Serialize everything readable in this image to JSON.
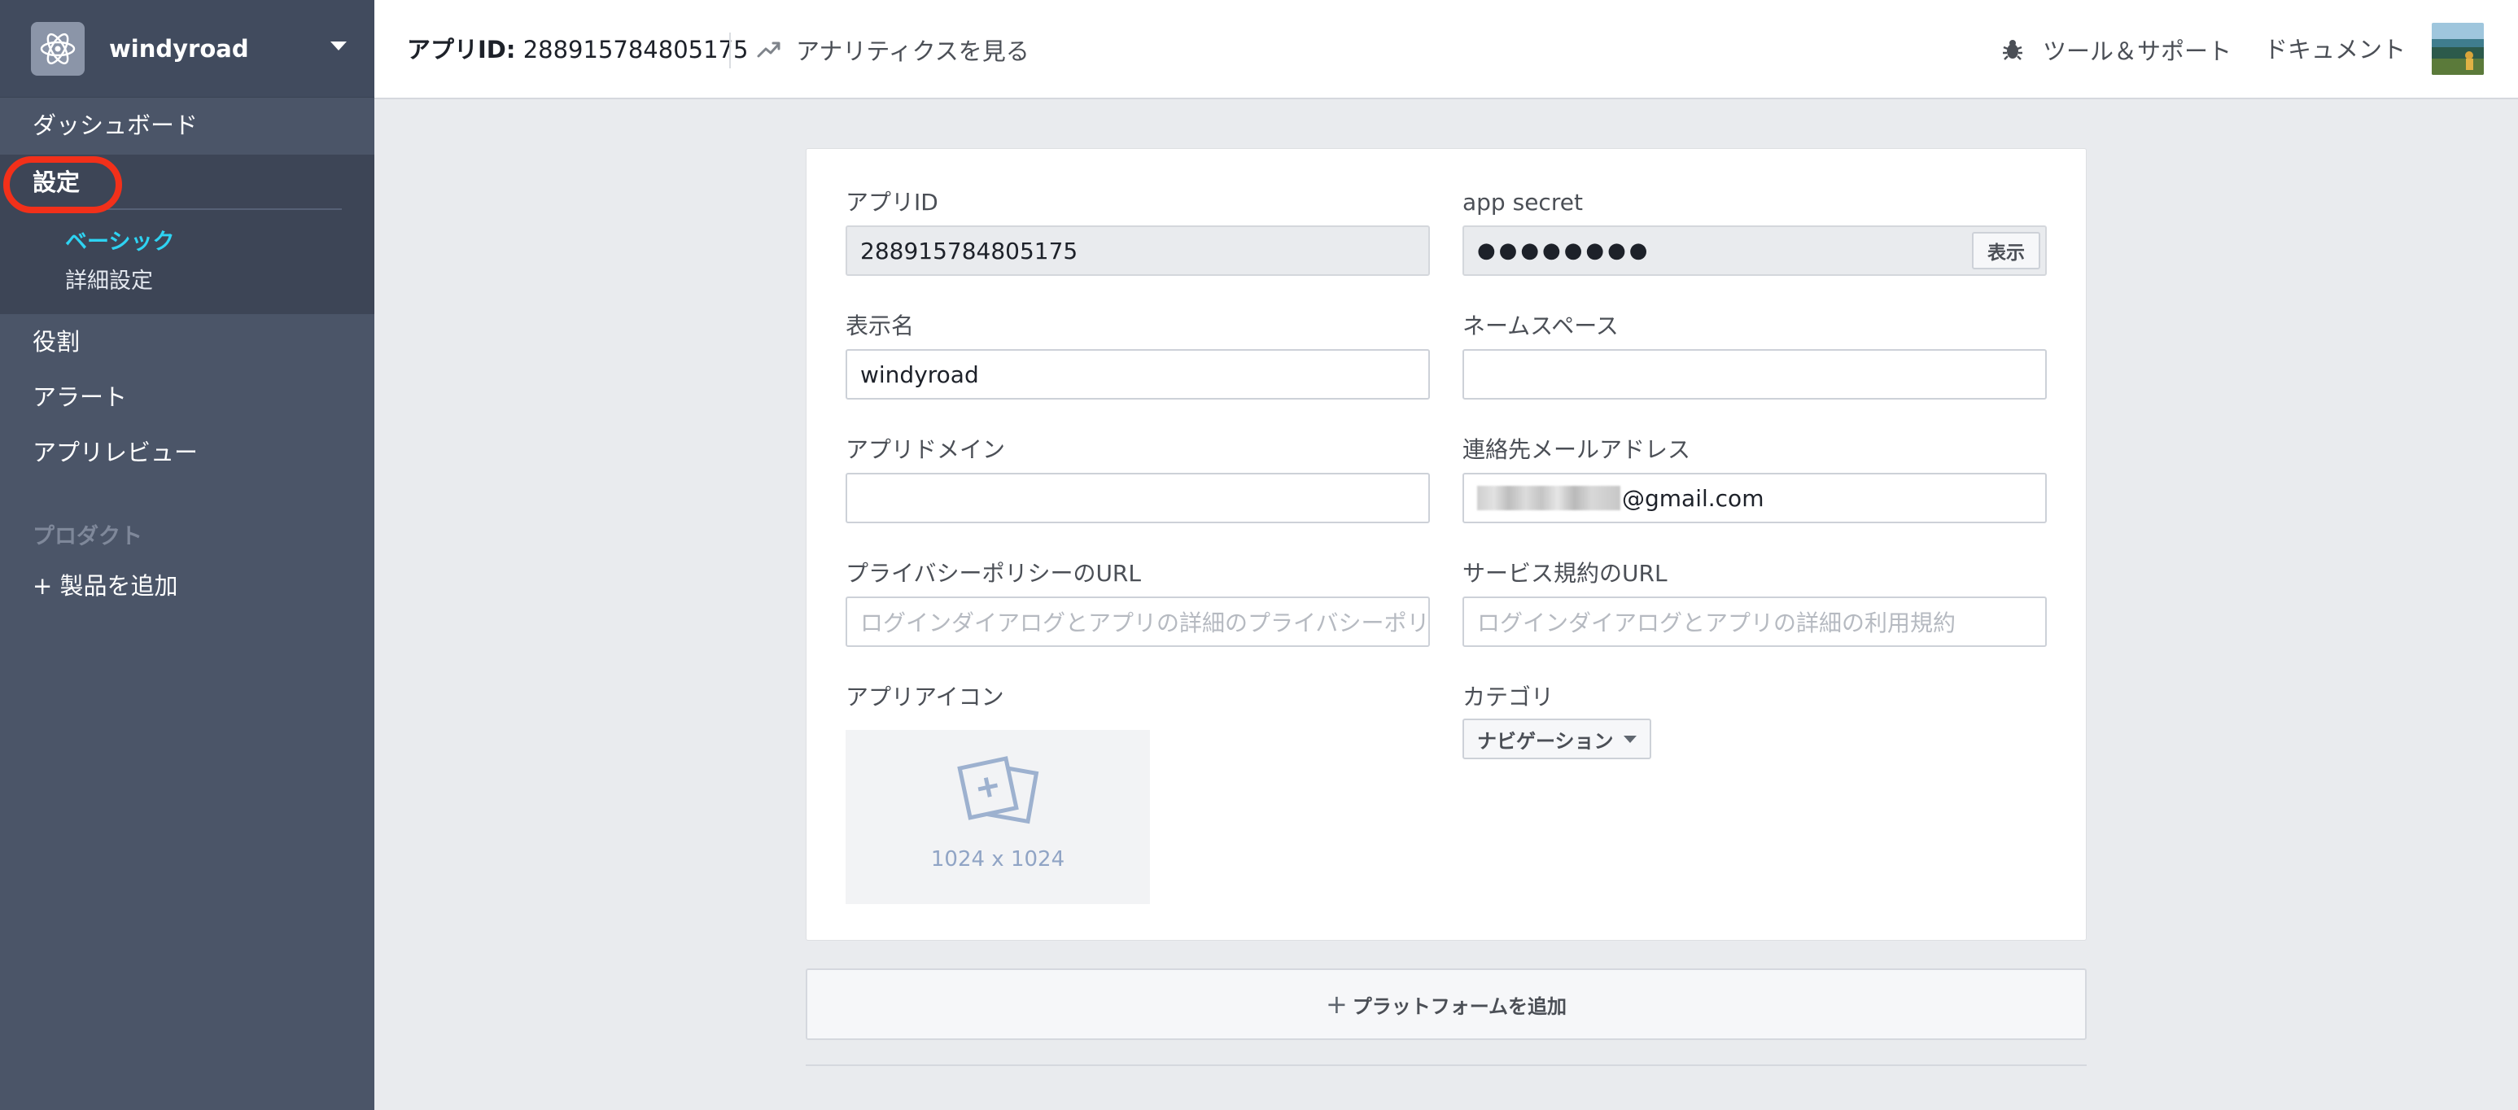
{
  "sidebar": {
    "app_name": "windyroad",
    "items": [
      {
        "label": "ダッシュボード"
      },
      {
        "label": "設定"
      },
      {
        "label": "役割"
      },
      {
        "label": "アラート"
      },
      {
        "label": "アプリレビュー"
      }
    ],
    "settings_sub": {
      "basic": "ベーシック",
      "advanced": "詳細設定"
    },
    "products_heading": "プロダクト",
    "add_product": "+ 製品を追加",
    "active_color": "#2ed3f2",
    "highlight_color": "#f2301a"
  },
  "topbar": {
    "app_id_label": "アプリID:",
    "app_id_value": "288915784805175",
    "analytics": "アナリティクスを見る",
    "tools_support": "ツール＆サポート",
    "documents": "ドキュメント"
  },
  "form": {
    "app_id": {
      "label": "アプリID",
      "value": "288915784805175"
    },
    "app_secret": {
      "label": "app secret",
      "value": "●●●●●●●●",
      "show_button": "表示"
    },
    "display_name": {
      "label": "表示名",
      "value": "windyroad"
    },
    "namespace": {
      "label": "ネームスペース",
      "value": ""
    },
    "app_domains": {
      "label": "アプリドメイン",
      "value": ""
    },
    "contact_email": {
      "label": "連絡先メールアドレス",
      "value_visible": "@gmail.com"
    },
    "privacy_url": {
      "label": "プライバシーポリシーのURL",
      "placeholder": "ログインダイアログとアプリの詳細のプライバシーポリ"
    },
    "terms_url": {
      "label": "サービス規約のURL",
      "placeholder": "ログインダイアログとアプリの詳細の利用規約"
    },
    "app_icon": {
      "label": "アプリアイコン",
      "size": "1024 x 1024"
    },
    "category": {
      "label": "カテゴリ",
      "value": "ナビゲーション"
    }
  },
  "add_platform": "プラットフォームを追加"
}
